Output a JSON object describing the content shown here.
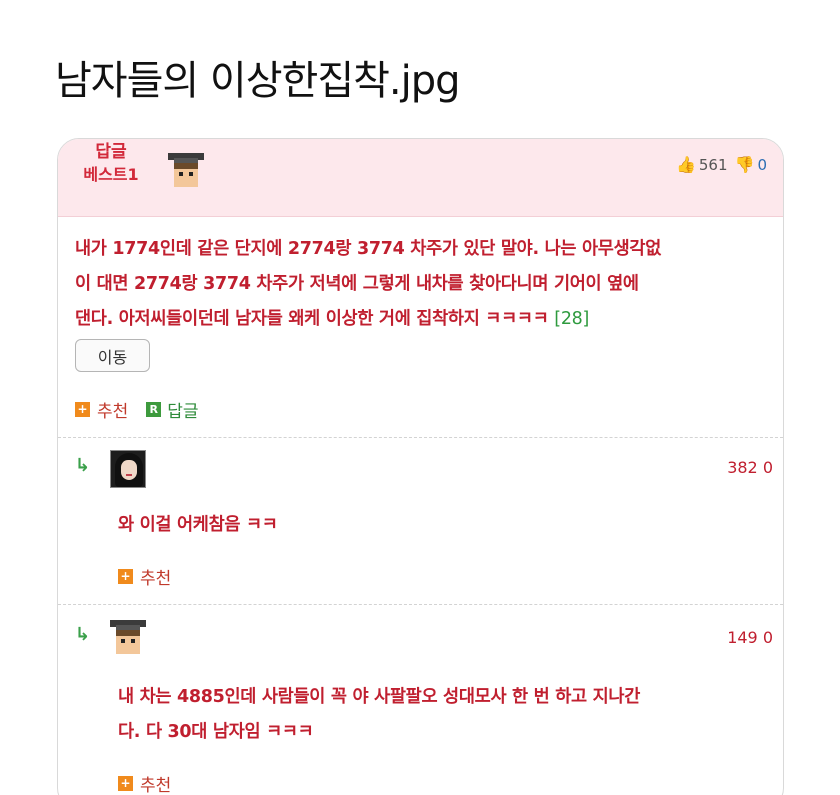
{
  "post": {
    "title": "남자들의 이상한집착.jpg"
  },
  "best_comment": {
    "label_line1": "답글",
    "label_line2": "베스트1",
    "likes": "561",
    "dislikes": "0",
    "line1": "내가 1774인데 같은 단지에 2774랑 3774 차주가 있단 말야. 나는 아무생각없",
    "line2": "이 대면 2774랑 3774 차주가 저녁에 그렇게 내차를 찾아다니며 기어이 옆에",
    "line3": "댄다. 아저씨들이던데 남자들 왜케 이상한 거에 집착하지 ㅋㅋㅋㅋ",
    "comment_count": "[28]",
    "move_button": "이동",
    "recommend": "추천",
    "reply": "답글",
    "plus_icon_text": "+",
    "r_icon_text": "R"
  },
  "replies": [
    {
      "likes": "382 0",
      "text": "와 이걸 어케참음 ㅋㅋ",
      "recommend": "추천"
    },
    {
      "likes": "149 0",
      "line1": "내 차는 4885인데 사람들이 꼭 야 사팔팔오 성대모사 한 번 하고 지나간",
      "line2": "다. 다 30대 남자임 ㅋㅋㅋ",
      "recommend": "추천"
    }
  ],
  "icons": {
    "thumbs_up": "👍",
    "thumbs_down": "👎",
    "reply_arrow": "↳"
  },
  "colors": {
    "accent_red": "#c01f2f",
    "best_bg": "#fde8ec",
    "green": "#2e9a3e",
    "orange": "#f08a1c"
  }
}
